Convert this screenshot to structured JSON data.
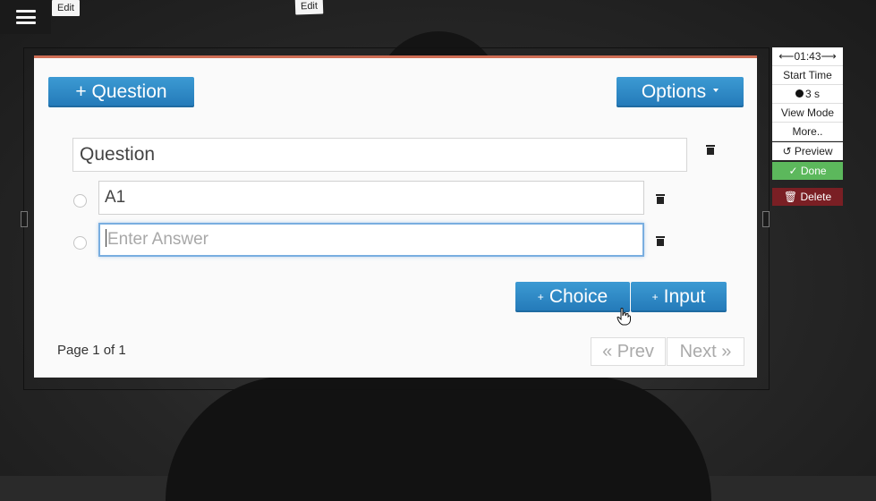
{
  "top": {
    "edit_label_1": "Edit",
    "edit_label_2": "Edit",
    "menu_icon": "hamburger-icon"
  },
  "question_card": {
    "add_question_label": "+ Question",
    "options_label": "Options",
    "question_value": "Question",
    "answers": [
      {
        "value": "A1"
      },
      {
        "placeholder": "Enter Answer"
      }
    ],
    "add_choice_label": "Choice",
    "add_input_label": "Input",
    "page_info": "Page 1 of 1",
    "prev_label": "« Prev",
    "next_label": "Next »"
  },
  "side_panel": {
    "time": "⟵01:43⟶",
    "start_time_label": "Start Time",
    "duration": "3 s",
    "view_mode_label": "View Mode",
    "more_label": "More..",
    "preview_label": "Preview",
    "done_label": "Done",
    "delete_label": "Delete"
  },
  "colors": {
    "accent_blue": "#2f8ac7",
    "done_green": "#5cb85c",
    "delete_red": "#7a1f24",
    "card_top_border": "#cf6e55"
  }
}
